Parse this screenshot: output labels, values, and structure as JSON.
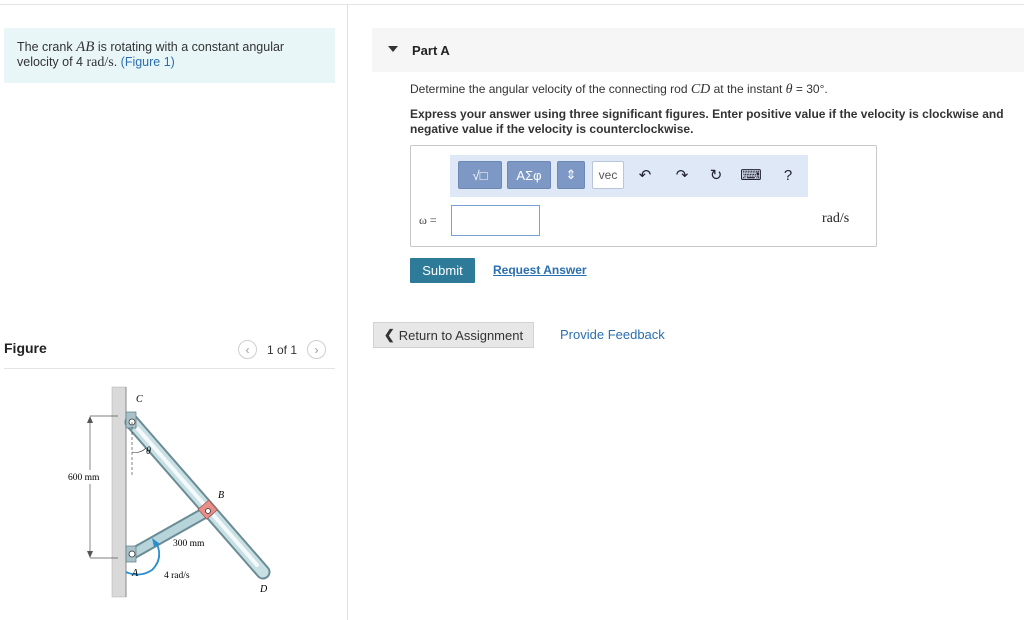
{
  "problem": {
    "prefix": "The crank ",
    "crank": "AB",
    "middle": " is rotating with a constant angular velocity of 4 ",
    "unit": "rad/s",
    "suffix": ". ",
    "figure_link": "(Figure 1)"
  },
  "figure": {
    "title": "Figure",
    "pager": "1 of 1",
    "labels": {
      "C": "C",
      "theta": "θ",
      "B": "B",
      "A": "A",
      "D": "D",
      "height": "600 mm",
      "crank_len": "300 mm",
      "omega": "4 rad/s"
    }
  },
  "part": {
    "title": "Part A",
    "question_prefix": "Determine the angular velocity of the connecting rod ",
    "rod": "CD",
    "question_mid": " at the instant ",
    "theta": "θ",
    "question_suffix": " = 30°.",
    "instructions": "Express your answer using three significant figures. Enter positive value if the velocity is clockwise and negative value if the velocity is counterclockwise.",
    "toolbar": {
      "templates": "√□",
      "greek": "ΑΣφ",
      "updown": "⇕",
      "vec": "vec",
      "undo": "↶",
      "redo": "↷",
      "reset": "↻",
      "keyboard": "⌨",
      "help": "?"
    },
    "variable": "ω =",
    "answer_value": "",
    "units": "rad/s",
    "submit": "Submit",
    "request_answer": "Request Answer"
  },
  "footer": {
    "return": "Return to Assignment",
    "feedback": "Provide Feedback"
  }
}
